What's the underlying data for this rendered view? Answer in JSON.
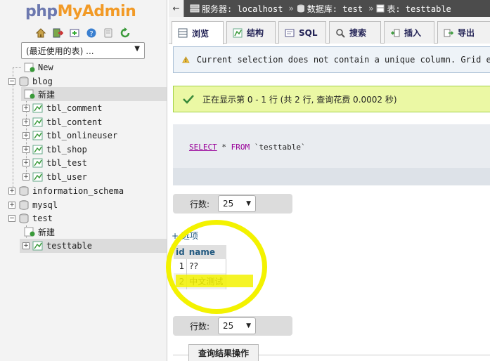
{
  "logo": {
    "php": "php",
    "admin": "MyAdmin"
  },
  "nav": {
    "quick_icons": [
      "home-icon",
      "logout-icon",
      "sql-query-icon",
      "help-icon",
      "docs-icon",
      "reload-icon"
    ],
    "recent_tables_value": "(最近使用的表) ...",
    "tree": {
      "new_root": "New",
      "db_blog": "blog",
      "blog_new": "新建",
      "blog_tables": [
        "tbl_comment",
        "tbl_content",
        "tbl_onlineuser",
        "tbl_shop",
        "tbl_test",
        "tbl_user"
      ],
      "db_information_schema": "information_schema",
      "db_mysql": "mysql",
      "db_test": "test",
      "test_new": "新建",
      "test_table": "testtable"
    }
  },
  "breadcrumb": {
    "server": "服务器: localhost",
    "database": "数据库: test",
    "table": "表: testtable"
  },
  "tabs": [
    "浏览",
    "结构",
    "SQL",
    "搜索",
    "插入",
    "导出"
  ],
  "messages": {
    "warning": "Current selection does not contain a unique column. Grid ed",
    "success": "正在显示第 0 - 1 行 (共 2 行, 查询花费 0.0002 秒)"
  },
  "sql": {
    "select": "SELECT",
    "star": " * ",
    "from": "FROM",
    "table": " `testtable`"
  },
  "rows_label": "行数:",
  "rows_value": "25",
  "options_link": "+ 选项",
  "result": {
    "columns": [
      "id",
      "name"
    ],
    "rows": [
      [
        "1",
        "??"
      ],
      [
        "2",
        "中文测试"
      ]
    ]
  },
  "result_ops_tab": "查询结果操作",
  "colors": {
    "highlight": "#f3f200",
    "success_bg": "#ebf8a4",
    "topbar": "#4c4c4c"
  }
}
